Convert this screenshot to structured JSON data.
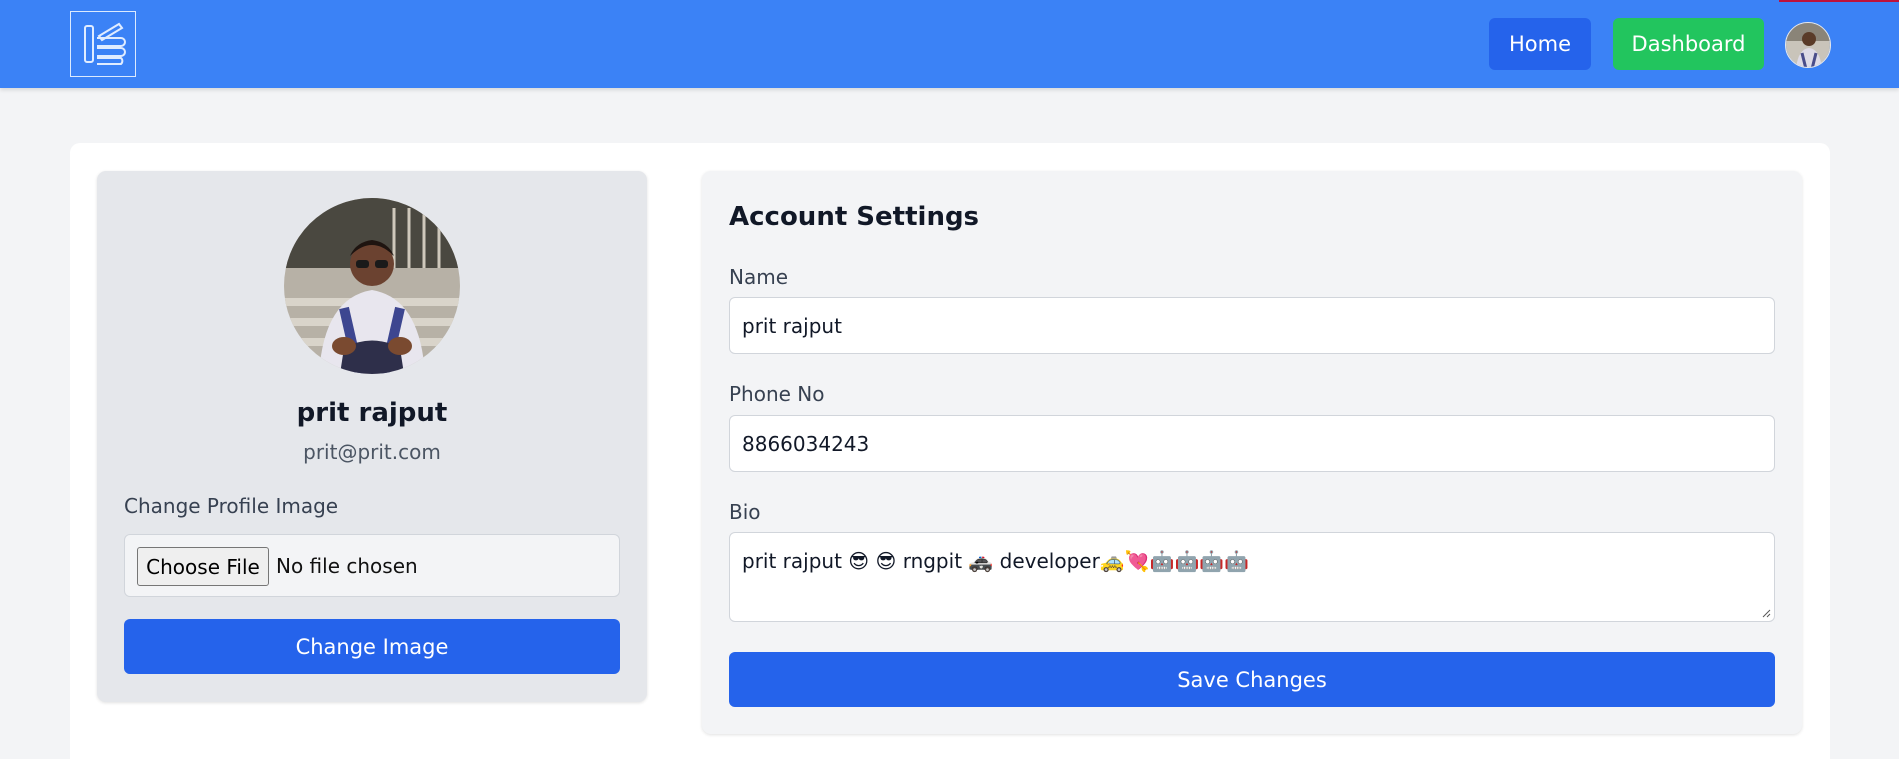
{
  "nav": {
    "home_label": "Home",
    "dashboard_label": "Dashboard"
  },
  "profile": {
    "name": "prit rajput",
    "email": "prit@prit.com",
    "change_image_label": "Change Profile Image",
    "file_button_label": "Choose File",
    "file_status": "No file chosen",
    "change_image_button": "Change Image"
  },
  "settings": {
    "title": "Account Settings",
    "name_label": "Name",
    "name_value": "prit rajput",
    "phone_label": "Phone No",
    "phone_value": "8866034243",
    "bio_label": "Bio",
    "bio_value": "prit rajput 😎 😎 rngpit 🚓 developer🚕💘🤖🤖🤖🤖",
    "save_button": "Save Changes"
  },
  "colors": {
    "topbar": "#3b82f6",
    "home_button": "#2563eb",
    "dashboard_button": "#22c55e",
    "primary": "#2563eb"
  }
}
